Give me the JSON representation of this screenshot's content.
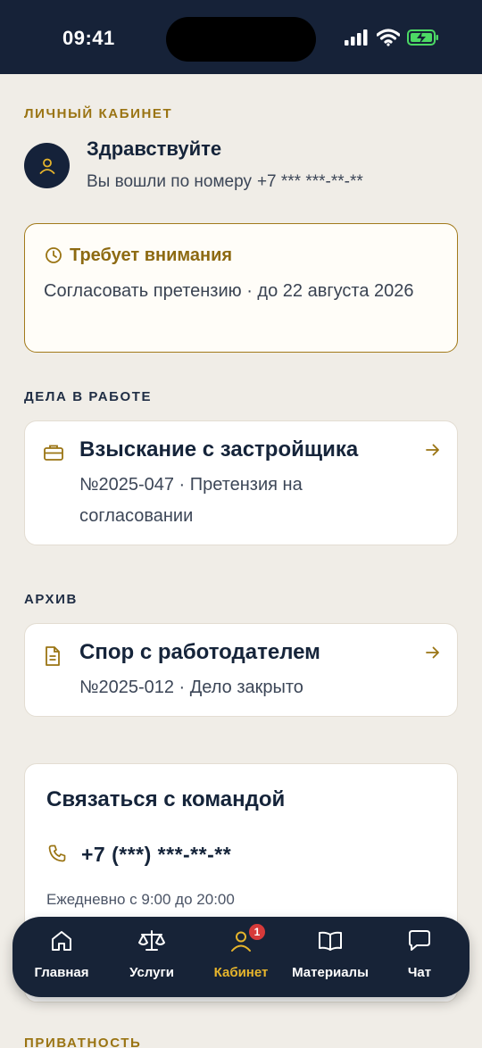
{
  "status_bar": {
    "time": "09:41",
    "icons": [
      "signal-icon",
      "wifi-icon",
      "battery-charging-icon"
    ]
  },
  "account": {
    "section_label": "ЛИЧНЫЙ КАБИНЕТ",
    "greeting": "Здравствуйте",
    "login_prefix": "Вы вошли по номеру",
    "phone_masked": "+7 *** ***-**-**",
    "avatar_icon": "user-icon"
  },
  "attention": {
    "title": "Требует внимания",
    "text": "Согласовать претензию · до 22 августа 2026",
    "icon": "clock-icon"
  },
  "cases_in_progress": {
    "section_label": "ДЕЛА В РАБОТЕ",
    "items": [
      {
        "title": "Взыскание с застройщика",
        "meta": "№2025-047 · Претензия на согласовании",
        "icon": "briefcase-icon"
      }
    ]
  },
  "archive": {
    "section_label": "АРХИВ",
    "items": [
      {
        "title": "Спор с работодателем",
        "meta": "№2025-012 · Дело закрыто",
        "icon": "document-icon"
      }
    ]
  },
  "contact": {
    "title": "Связаться с командой",
    "phone": "+7 (***) ***-**-**",
    "hours": "Ежедневно с 9:00 до 20:00",
    "icon": "phone-icon"
  },
  "privacy": {
    "section_label": "ПРИВАТНОСТЬ"
  },
  "bottom_nav": {
    "items": [
      {
        "label": "Главная",
        "icon": "home-icon"
      },
      {
        "label": "Услуги",
        "icon": "scales-icon"
      },
      {
        "label": "Кабинет",
        "icon": "user-icon",
        "active": true,
        "badge": "1"
      },
      {
        "label": "Материалы",
        "icon": "book-icon"
      },
      {
        "label": "Чат",
        "icon": "chat-icon"
      }
    ]
  },
  "colors": {
    "navy": "#162238",
    "gold": "#9a7413",
    "accent_active": "#e7b52c",
    "badge": "#d63a3a",
    "background": "#f0ede7"
  }
}
